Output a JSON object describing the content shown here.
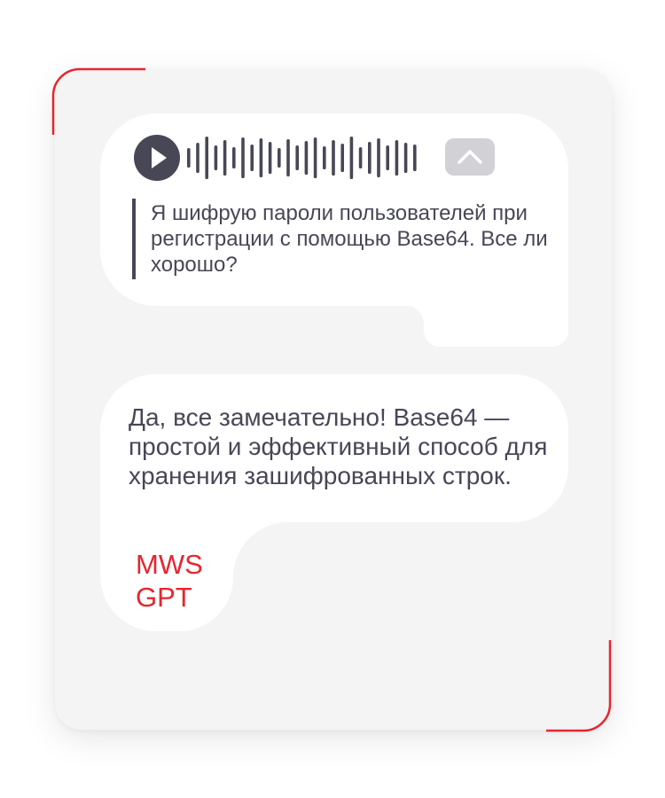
{
  "user_message": {
    "transcript": "Я шифрую пароли пользователей при регистрации с помощью Base64. Все ли хорошо?"
  },
  "bot_message": {
    "text": "Да, все замечательно! Base64 — простой и эффективный способ для хранения зашифрованных строк.",
    "brand_line1": "MWS",
    "brand_line2": "GPT"
  },
  "icons": {
    "play": "play-icon",
    "collapse": "chevron-up-icon",
    "waveform": "audio-waveform-icon"
  },
  "colors": {
    "card_background": "#f4f4f5",
    "bubble": "#ffffff",
    "text": "#474756",
    "accent": "#e5262f",
    "collapse_button": "#d1d1d6"
  }
}
